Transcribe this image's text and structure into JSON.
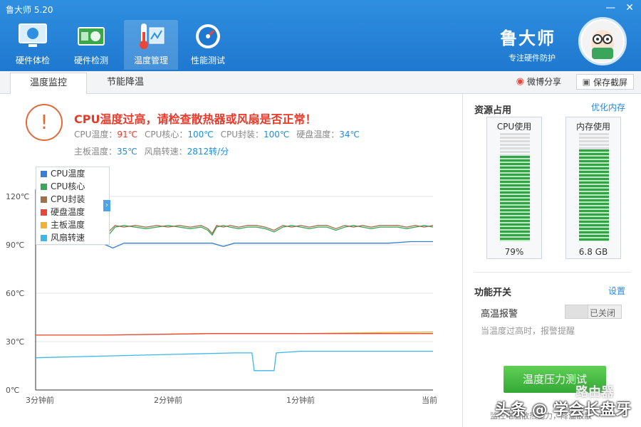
{
  "window": {
    "title": "鲁大师 5.20"
  },
  "toolbar": {
    "tools": [
      {
        "label": "硬件体检"
      },
      {
        "label": "硬件检测"
      },
      {
        "label": "温度管理"
      },
      {
        "label": "性能测试"
      }
    ]
  },
  "brand": {
    "name": "鲁大师",
    "slogan": "专注硬件防护"
  },
  "tabs": [
    {
      "label": "温度监控"
    },
    {
      "label": "节能降温"
    }
  ],
  "actions": {
    "share": "微博分享",
    "screenshot": "保存截屏"
  },
  "warning": {
    "title": "CPU温度过高，请检查散热器或风扇是否正常！",
    "stats": [
      {
        "label": "CPU温度：",
        "value": "91℃"
      },
      {
        "label": "CPU核心：",
        "value": "100℃"
      },
      {
        "label": "CPU封装：",
        "value": "100℃"
      },
      {
        "label": "硬盘温度：",
        "value": "34℃"
      },
      {
        "label": "主板温度：",
        "value": "35℃"
      },
      {
        "label": "风扇转速：",
        "value": "2812转/分"
      }
    ]
  },
  "legend": [
    {
      "name": "CPU温度",
      "color": "#3a7fd5"
    },
    {
      "name": "CPU核心",
      "color": "#3aa65b"
    },
    {
      "name": "CPU封装",
      "color": "#a0704a"
    },
    {
      "name": "硬盘温度",
      "color": "#e8483b"
    },
    {
      "name": "主板温度",
      "color": "#f2b134"
    },
    {
      "name": "风扇转速",
      "color": "#3bb7e8"
    }
  ],
  "chart_data": {
    "type": "line",
    "y_ticks": [
      "120℃",
      "90℃",
      "60℃",
      "30℃",
      "0℃"
    ],
    "y_tick_values": [
      120,
      90,
      60,
      30,
      0
    ],
    "x_ticks": [
      "3分钟前",
      "2分钟前",
      "1分钟前",
      "当前"
    ],
    "x_tick_values": [
      180,
      120,
      60,
      0
    ],
    "ylim": [
      0,
      120
    ],
    "xlim": [
      180,
      0
    ],
    "grid": true,
    "series": [
      {
        "name": "CPU核心",
        "color": "#3aa65b",
        "x": [
          180,
          175,
          170,
          165,
          160,
          155,
          150,
          147,
          144,
          140,
          135,
          130,
          125,
          120,
          115,
          110,
          105,
          102,
          100,
          98,
          95,
          92,
          88,
          84,
          80,
          76,
          72,
          68,
          64,
          60,
          56,
          52,
          48,
          44,
          40,
          36,
          32,
          28,
          24,
          20,
          16,
          12,
          8,
          4,
          0
        ],
        "values": [
          101,
          101,
          102,
          101,
          100,
          101,
          102,
          96,
          101,
          102,
          101,
          100,
          101,
          102,
          101,
          100,
          101,
          99,
          96,
          101,
          102,
          101,
          100,
          101,
          101,
          100,
          98,
          101,
          102,
          101,
          100,
          101,
          101,
          99,
          101,
          102,
          101,
          100,
          101,
          101,
          101,
          100,
          101,
          102,
          101
        ]
      },
      {
        "name": "CPU封装",
        "color": "#a0704a",
        "x": [
          180,
          175,
          170,
          165,
          160,
          155,
          150,
          147,
          144,
          140,
          135,
          130,
          125,
          120,
          115,
          110,
          105,
          102,
          100,
          98,
          95,
          92,
          88,
          84,
          80,
          76,
          72,
          68,
          64,
          60,
          56,
          52,
          48,
          44,
          40,
          36,
          32,
          28,
          24,
          20,
          16,
          12,
          8,
          4,
          0
        ],
        "values": [
          102,
          102,
          101,
          102,
          101,
          102,
          101,
          98,
          102,
          101,
          102,
          101,
          102,
          101,
          102,
          101,
          102,
          100,
          97,
          102,
          101,
          102,
          101,
          102,
          102,
          101,
          99,
          102,
          101,
          102,
          101,
          102,
          102,
          100,
          102,
          101,
          102,
          101,
          102,
          102,
          102,
          101,
          102,
          101,
          102
        ]
      },
      {
        "name": "CPU温度",
        "color": "#3a7fd5",
        "x": [
          180,
          170,
          160,
          150,
          145,
          140,
          130,
          120,
          110,
          100,
          95,
          90,
          80,
          70,
          60,
          50,
          40,
          30,
          20,
          10,
          0
        ],
        "values": [
          91,
          91,
          91,
          91,
          88,
          91,
          91,
          91,
          91,
          91,
          89,
          91,
          91,
          91,
          91,
          91,
          91,
          91,
          91,
          92,
          92
        ]
      },
      {
        "name": "主板温度",
        "color": "#f2b134",
        "x": [
          180,
          150,
          100,
          60,
          0
        ],
        "values": [
          34,
          34,
          35,
          35,
          36
        ]
      },
      {
        "name": "硬盘温度",
        "color": "#e8483b",
        "x": [
          180,
          150,
          100,
          60,
          0
        ],
        "values": [
          34,
          34,
          35,
          35,
          35
        ]
      },
      {
        "name": "风扇转速",
        "color": "#3bb7e8",
        "x": [
          180,
          150,
          120,
          90,
          82,
          81,
          72,
          71,
          60,
          30,
          0
        ],
        "values": [
          20,
          21,
          22,
          23,
          23,
          12,
          12,
          23,
          24,
          24,
          24
        ]
      }
    ]
  },
  "sidebar": {
    "resource_title": "资源占用",
    "optimize_link": "优化内存",
    "cpu": {
      "label": "CPU使用",
      "value": "79%",
      "level": 0.79
    },
    "memory": {
      "label": "内存使用",
      "value": "6.8 GB",
      "level": 0.85
    },
    "function_title": "功能开关",
    "settings_link": "设置",
    "alarm_label": "高温报警",
    "alarm_state": "已关闭",
    "alarm_desc": "当温度过高时，报警提醒",
    "stress_button": "温度压力测试",
    "bottom_note": "监控电脑散热能力，降温散散"
  },
  "watermark": {
    "text": "头条 @ 学会长盘牙",
    "logo_text": "路由器"
  }
}
